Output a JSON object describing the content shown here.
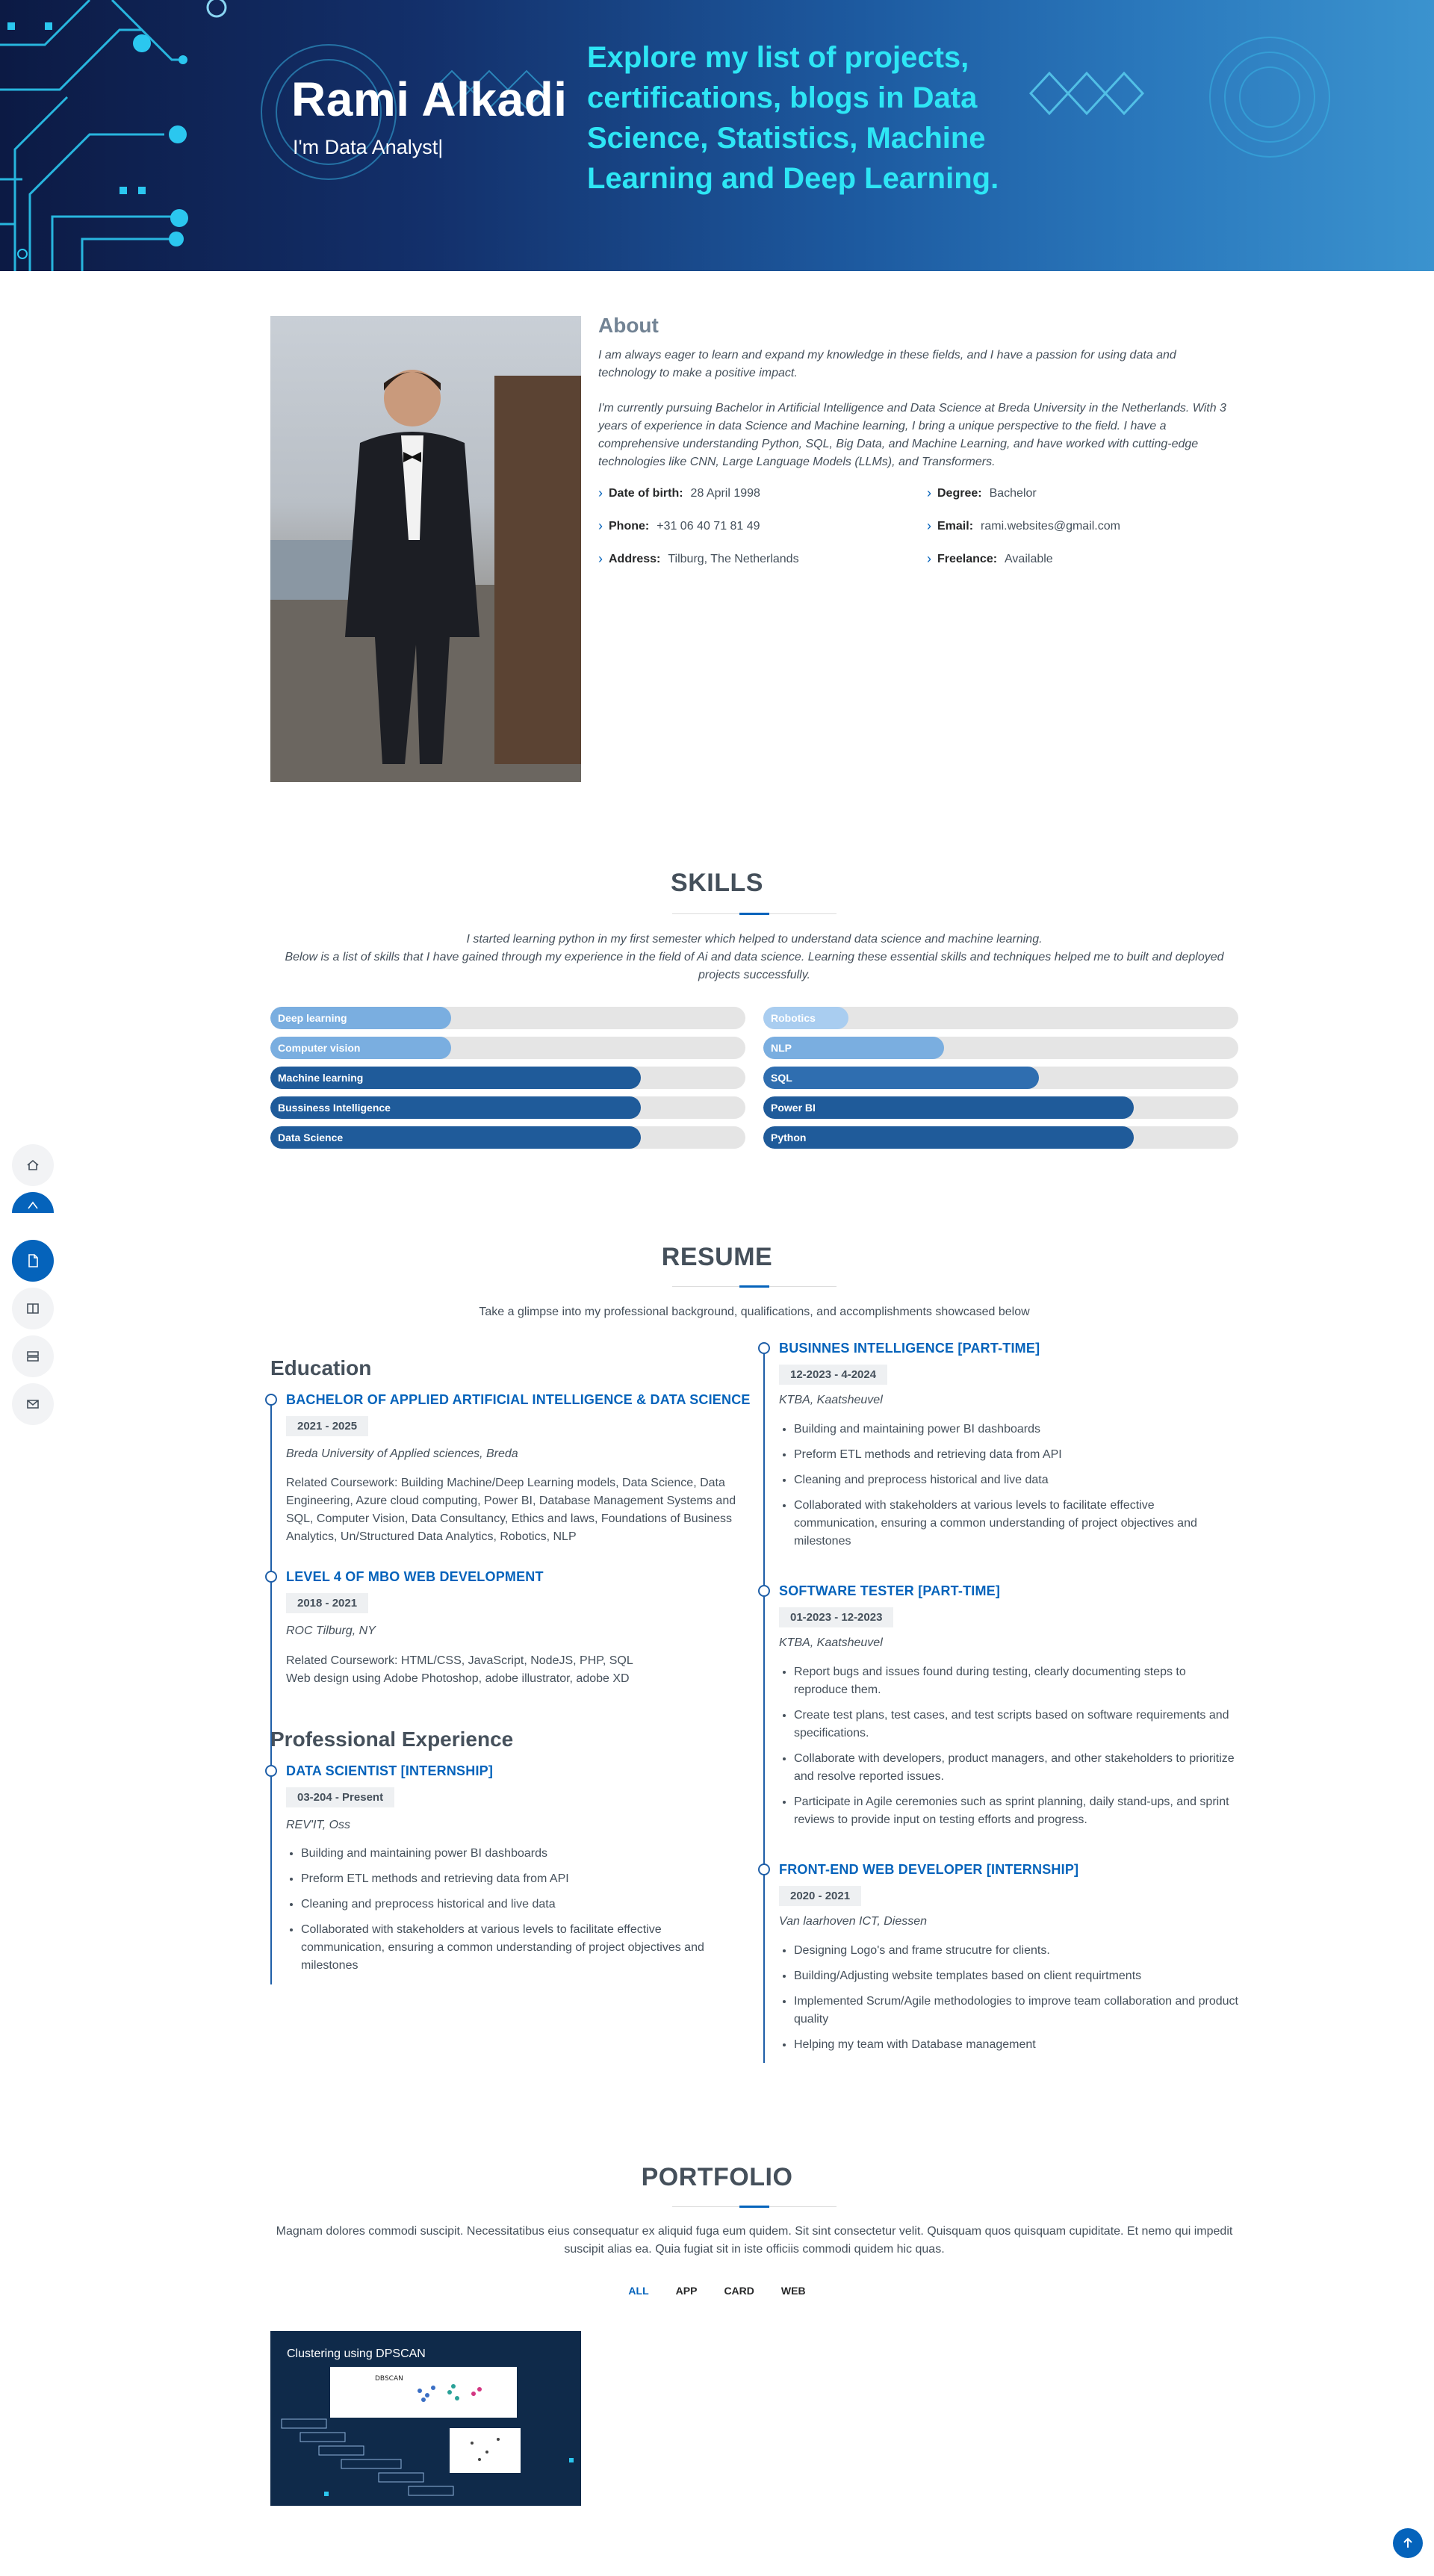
{
  "hero": {
    "name": "Rami Alkadi",
    "role": "I'm Data Analyst|",
    "tagline": "Explore my list of projects, certifications, blogs in Data Science, Statistics, Machine Learning and Deep Learning."
  },
  "nav": {
    "items": [
      "home-icon",
      "person-icon",
      "file-icon",
      "book-icon",
      "server-icon",
      "envelope-icon"
    ],
    "active": "file-icon"
  },
  "about": {
    "title": "About",
    "p1": "I am always eager to learn and expand my knowledge in these fields, and I have a passion for using data and technology to make a positive impact.",
    "p2": "I'm currently pursuing Bachelor in Artificial Intelligence and Data Science at Breda University in the Netherlands. With 3 years of experience in data Science and Machine learning, I bring a unique perspective to the field. I have a comprehensive understanding Python, SQL, Big Data, and Machine Learning, and have worked with cutting-edge technologies like CNN, Large Language Models (LLMs), and Transformers.",
    "info": [
      {
        "label": "Date of birth:",
        "value": "28 April 1998"
      },
      {
        "label": "Degree:",
        "value": "Bachelor"
      },
      {
        "label": "Phone:",
        "value": "+31 06 40 71 81 49"
      },
      {
        "label": "Email:",
        "value": "rami.websites@gmail.com"
      },
      {
        "label": "Address:",
        "value": "Tilburg, The Netherlands"
      },
      {
        "label": "Freelance:",
        "value": "Available"
      }
    ]
  },
  "skills": {
    "title": "SKILLS",
    "desc1": "I started learning python in my first semester which helped to understand data science and machine learning.",
    "desc2": "Below is a list of skills that I have gained through my experience in the field of Ai and data science. Learning these essential skills and techniques helped me to built and deployed projects successfully.",
    "left": [
      {
        "name": "Deep learning",
        "level": 0.38,
        "color": "#7aaee0"
      },
      {
        "name": "Computer vision",
        "level": 0.38,
        "color": "#7aaee0"
      },
      {
        "name": "Machine learning",
        "level": 0.78,
        "color": "#1f5b9a"
      },
      {
        "name": "Bussiness Intelligence",
        "level": 0.78,
        "color": "#1f5b9a"
      },
      {
        "name": "Data Science",
        "level": 0.78,
        "color": "#1f5b9a"
      }
    ],
    "right": [
      {
        "name": "Robotics",
        "level": 0.18,
        "color": "#a9cdf0"
      },
      {
        "name": "NLP",
        "level": 0.38,
        "color": "#7aaee0"
      },
      {
        "name": "SQL",
        "level": 0.58,
        "color": "#2f6eb0"
      },
      {
        "name": "Power BI",
        "level": 0.78,
        "color": "#1f5b9a"
      },
      {
        "name": "Python",
        "level": 0.78,
        "color": "#1f5b9a"
      }
    ]
  },
  "resume": {
    "title": "RESUME",
    "desc": "Take a glimpse into my professional background, qualifications, and accomplishments showcased below",
    "education_title": "Education",
    "experience_title": "Professional Experience",
    "edu1": {
      "title": "BACHELOR OF APPLIED ARTIFICIAL INTELLIGENCE & DATA SCIENCE",
      "date": "2021 - 2025",
      "org": "Breda University of Applied sciences, Breda",
      "text": "Related Coursework: Building Machine/Deep Learning models, Data Science, Data Engineering, Azure cloud computing, Power BI, Database Management Systems and SQL, Computer Vision, Data Consultancy, Ethics and laws, Foundations of Business Analytics, Un/Structured Data Analytics, Robotics, NLP"
    },
    "edu2": {
      "title": "LEVEL 4 OF MBO WEB DEVELOPMENT",
      "date": "2018 - 2021",
      "org": "ROC Tilburg, NY",
      "text1": "Related Coursework: HTML/CSS, JavaScript, NodeJS, PHP, SQL",
      "text2": "Web design using Adobe Photoshop, adobe illustrator, adobe XD"
    },
    "exp1": {
      "title": "DATA SCIENTIST [INTERNSHIP]",
      "date": "03-204 - Present",
      "org": "REV'IT, Oss",
      "items": [
        "Building and maintaining power BI dashboards",
        "Preform ETL methods and retrieving data from API",
        "Cleaning and preprocess historical and live data",
        "Collaborated with stakeholders at various levels to facilitate effective communication, ensuring a common understanding of project objectives and milestones"
      ]
    },
    "exp2": {
      "title": "BUSINNES INTELLIGENCE [PART-TIME]",
      "date": "12-2023 - 4-2024",
      "org": "KTBA, Kaatsheuvel",
      "items": [
        "Building and maintaining power BI dashboards",
        "Preform ETL methods and retrieving data from API",
        "Cleaning and preprocess historical and live data",
        "Collaborated with stakeholders at various levels to facilitate effective communication, ensuring a common understanding of project objectives and milestones"
      ]
    },
    "exp3": {
      "title": "SOFTWARE TESTER [PART-TIME]",
      "date": "01-2023 - 12-2023",
      "org": "KTBA, Kaatsheuvel",
      "items": [
        "Report bugs and issues found during testing, clearly documenting steps to reproduce them.",
        "Create test plans, test cases, and test scripts based on software requirements and specifications.",
        "Collaborate with developers, product managers, and other stakeholders to prioritize and resolve reported issues.",
        "Participate in Agile ceremonies such as sprint planning, daily stand-ups, and sprint reviews to provide input on testing efforts and progress."
      ]
    },
    "exp4": {
      "title": "FRONT-END WEB DEVELOPER [INTERNSHIP]",
      "date": "2020 - 2021",
      "org": "Van laarhoven ICT, Diessen",
      "items": [
        "Designing Logo's and frame strucutre for clients.",
        "Building/Adjusting website templates based on client requirtments",
        "Implemented Scrum/Agile methodologies to improve team collaboration and product quality",
        "Helping my team with Database management"
      ]
    }
  },
  "portfolio": {
    "title": "PORTFOLIO",
    "desc": "Magnam dolores commodi suscipit. Necessitatibus eius consequatur ex aliquid fuga eum quidem. Sit sint consectetur velit. Quisquam quos quisquam cupiditate. Et nemo qui impedit suscipit alias ea. Quia fugiat sit in iste officiis commodi quidem hic quas.",
    "filters": [
      "ALL",
      "APP",
      "CARD",
      "WEB"
    ],
    "active_filter": "ALL",
    "card_title": "Clustering using DPSCAN",
    "card_diagram_label": "DBSCAN"
  },
  "back_to_top": "arrow-up-icon"
}
